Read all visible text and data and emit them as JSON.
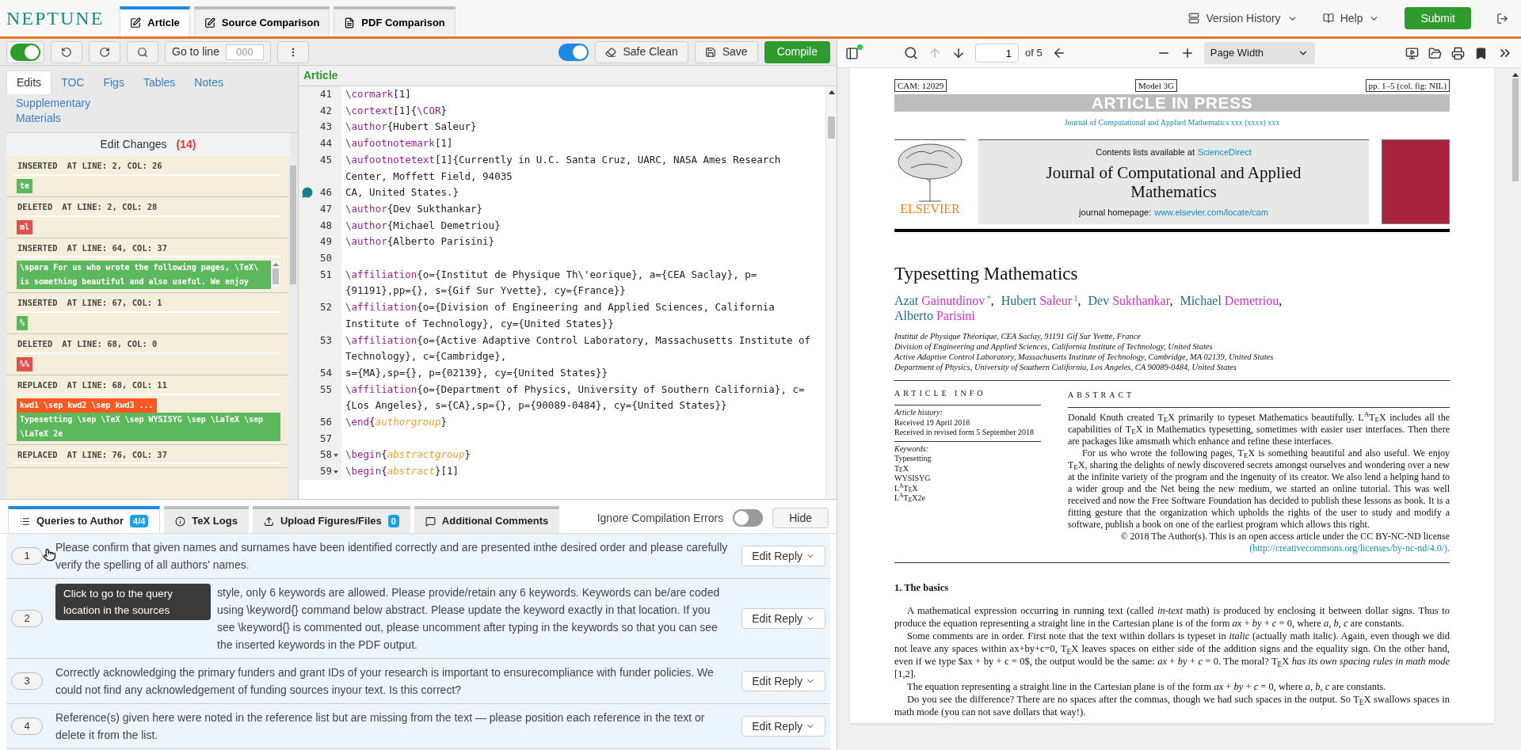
{
  "app": {
    "logo": "NEPTUNE"
  },
  "tabs": [
    {
      "label": "Article",
      "selected": true
    },
    {
      "label": "Source Comparison",
      "selected": false
    },
    {
      "label": "PDF Comparison",
      "selected": false
    }
  ],
  "menus": [
    {
      "label": "Version History"
    },
    {
      "label": "Help"
    }
  ],
  "submit": "Submit",
  "toolbar": {
    "track_on": true,
    "goto_label": "Go to line",
    "goto_placeholder": "000",
    "clean_on": true,
    "safe_clean": "Safe Clean",
    "save": "Save",
    "compile": "Compile"
  },
  "side_tabs": [
    {
      "label": "Edits",
      "selected": true
    },
    {
      "label": "TOC",
      "selected": false
    },
    {
      "label": "Figs",
      "selected": false
    },
    {
      "label": "Tables",
      "selected": false
    },
    {
      "label": "Notes",
      "selected": false
    },
    {
      "label": "Supplementary Materials",
      "selected": false
    }
  ],
  "edit_changes": {
    "title": "Edit Changes",
    "count": "(14)",
    "items": [
      {
        "kind": "inserted",
        "action": "INSERTED",
        "location": "AT LINE: 2, COL: 26",
        "added": "te",
        "scrollable": false
      },
      {
        "kind": "deleted",
        "action": "DELETED",
        "location": "AT LINE: 2, COL: 28",
        "removed": "ml",
        "scrollable": false
      },
      {
        "kind": "inserted",
        "action": "INSERTED",
        "location": "AT LINE: 64, COL: 37",
        "added": "\\spara For us who wrote the following pages, \\TeX\\ is something beautiful and also useful. We enjoy",
        "scrollable": true
      },
      {
        "kind": "inserted",
        "action": "INSERTED",
        "location": "AT LINE: 67, COL: 1",
        "added": "%",
        "scrollable": false
      },
      {
        "kind": "deleted",
        "action": "DELETED",
        "location": "AT LINE: 68, COL: 0",
        "removed": "%%",
        "scrollable": false
      },
      {
        "kind": "replaced",
        "action": "REPLACED",
        "location": "AT LINE: 68, COL: 11",
        "removed": "kwd1 \\sep kwd2 \\sep kwd3 ...",
        "added": "Typesetting \\sep \\TeX \\sep WYSISYG \\sep \\LaTeX \\sep \\LaTeX 2e",
        "scrollable": false
      },
      {
        "kind": "replaced",
        "action": "REPLACED",
        "location": "AT LINE: 76, COL: 37",
        "scrollable": false
      }
    ]
  },
  "editor": {
    "title": "Article",
    "lines": [
      {
        "number": "41",
        "comment": false,
        "foldable": false,
        "tokens": [
          {
            "kind": "command",
            "text": "\\cormark"
          },
          {
            "kind": "plain",
            "text": "[1]"
          }
        ]
      },
      {
        "number": "42",
        "comment": false,
        "foldable": false,
        "tokens": [
          {
            "kind": "command",
            "text": "\\cortext"
          },
          {
            "kind": "plain",
            "text": "[1]{"
          },
          {
            "kind": "command",
            "text": "\\COR"
          },
          {
            "kind": "plain",
            "text": "}"
          }
        ]
      },
      {
        "number": "43",
        "comment": false,
        "foldable": false,
        "tokens": [
          {
            "kind": "command",
            "text": "\\author"
          },
          {
            "kind": "plain",
            "text": "{Hubert Saleur}"
          }
        ]
      },
      {
        "number": "44",
        "comment": false,
        "foldable": false,
        "tokens": [
          {
            "kind": "command",
            "text": "\\aufootnotemark"
          },
          {
            "kind": "plain",
            "text": "[1]"
          }
        ]
      },
      {
        "number": "45",
        "comment": false,
        "foldable": false,
        "tokens": [
          {
            "kind": "command",
            "text": "\\aufootnotetext"
          },
          {
            "kind": "plain",
            "text": "[1]{Currently in U.C. Santa Cruz, UARC, NASA Ames Research Center, Moffett Field, 94035"
          }
        ]
      },
      {
        "number": "46",
        "comment": true,
        "foldable": false,
        "tokens": [
          {
            "kind": "plain",
            "text": "CA, United States.}"
          }
        ]
      },
      {
        "number": "47",
        "comment": false,
        "foldable": false,
        "tokens": [
          {
            "kind": "command",
            "text": "\\author"
          },
          {
            "kind": "plain",
            "text": "{Dev Sukthankar}"
          }
        ]
      },
      {
        "number": "48",
        "comment": false,
        "foldable": false,
        "tokens": [
          {
            "kind": "command",
            "text": "\\author"
          },
          {
            "kind": "plain",
            "text": "{Michael Demetriou}"
          }
        ]
      },
      {
        "number": "49",
        "comment": false,
        "foldable": false,
        "tokens": [
          {
            "kind": "command",
            "text": "\\author"
          },
          {
            "kind": "plain",
            "text": "{Alberto Parisini}"
          }
        ]
      },
      {
        "number": "50",
        "comment": false,
        "foldable": false
      },
      {
        "number": "51",
        "comment": false,
        "foldable": false,
        "tokens": [
          {
            "kind": "command",
            "text": "\\affiliation"
          },
          {
            "kind": "plain",
            "text": "{o={Institut de Physique Th\\'eorique}, a={CEA Saclay}, p={91191},pp={}, s={Gif Sur Yvette}, cy={France}}"
          }
        ]
      },
      {
        "number": "52",
        "comment": false,
        "foldable": false,
        "tokens": [
          {
            "kind": "command",
            "text": "\\affiliation"
          },
          {
            "kind": "plain",
            "text": "{o={Division of Engineering and Applied Sciences, California Institute of Technology}, cy={United States}}"
          }
        ]
      },
      {
        "number": "53",
        "comment": false,
        "foldable": false,
        "tokens": [
          {
            "kind": "command",
            "text": "\\affiliation"
          },
          {
            "kind": "plain",
            "text": "{o={Active Adaptive Control Laboratory, Massachusetts Institute of Technology}, c={Cambridge},"
          }
        ]
      },
      {
        "number": "54",
        "comment": false,
        "foldable": false,
        "tokens": [
          {
            "kind": "plain",
            "text": "s={MA},sp={}, p={02139}, cy={United States}}"
          }
        ]
      },
      {
        "number": "55",
        "comment": false,
        "foldable": false,
        "tokens": [
          {
            "kind": "command",
            "text": "\\affiliation"
          },
          {
            "kind": "plain",
            "text": "{o={Department of Physics, University of Southern California}, c={Los Angeles}, s={CA},sp={}, p={90089-0484}, cy={United States}}"
          }
        ]
      },
      {
        "number": "56",
        "comment": false,
        "foldable": false,
        "tokens": [
          {
            "kind": "command",
            "text": "\\end"
          },
          {
            "kind": "plain",
            "text": "{"
          },
          {
            "kind": "environment",
            "text": "authorgroup"
          },
          {
            "kind": "plain",
            "text": "}"
          }
        ]
      },
      {
        "number": "57",
        "comment": false,
        "foldable": false
      },
      {
        "number": "58",
        "comment": false,
        "foldable": true,
        "tokens": [
          {
            "kind": "command",
            "text": "\\begin"
          },
          {
            "kind": "plain",
            "text": "{"
          },
          {
            "kind": "environment",
            "text": "abstractgroup"
          },
          {
            "kind": "plain",
            "text": "}"
          }
        ]
      },
      {
        "number": "59",
        "comment": false,
        "foldable": true,
        "tokens": [
          {
            "kind": "command",
            "text": "\\begin"
          },
          {
            "kind": "plain",
            "text": "{"
          },
          {
            "kind": "environment",
            "text": "abstract"
          },
          {
            "kind": "plain",
            "text": "}[1]"
          }
        ]
      }
    ]
  },
  "bottom_tabs": [
    {
      "label": "Queries to Author",
      "badge": "4/4",
      "selected": true
    },
    {
      "label": "TeX Logs",
      "selected": false
    },
    {
      "label": "Upload Figures/Files",
      "badge": "0",
      "selected": false
    },
    {
      "label": "Additional Comments",
      "selected": false
    }
  ],
  "ignore_errors": {
    "label": "Ignore Compilation Errors",
    "on": false
  },
  "hide": "Hide",
  "queries": [
    {
      "number": "1",
      "text": "Please confirm that given names and surnames have been identified correctly and are presented inthe desired order and please carefully verify the spelling of all authors' names.",
      "action": "Edit Reply",
      "tooltip": "Click to go to the query location in the sources"
    },
    {
      "number": "2",
      "text": "style, only 6 keywords are allowed. Please provide/retain any 6 keywords. Keywords can be/are coded using \\keyword{} command below abstract. Please update the keyword exactly in that location. If you see \\keyword{} is commented out, please uncomment after typing in the keywords so that you can see the inserted keywords in the PDF output.",
      "action": "Edit Reply"
    },
    {
      "number": "3",
      "text": "Correctly acknowledging the primary funders and grant IDs of your research is important to ensurecompliance with funder policies. We could not find any acknowledgement of funding sources inyour text. Is this correct?",
      "action": "Edit Reply"
    },
    {
      "number": "4",
      "text": "Reference(s) given here were noted in the reference list but are missing from the text — please position each reference in the text or delete it from the list.",
      "action": "Edit Reply"
    }
  ],
  "pdf": {
    "toolbar": {
      "page": "1",
      "of": "of 5",
      "zoom": "Page Width"
    },
    "page": {
      "header": [
        "CAM: 12029",
        "Model 3G",
        "pp. 1–5 (col. fig: NIL)"
      ],
      "banner": "ARTICLE IN PRESS",
      "journal_ref": "Journal of Computational and Applied Mathematics xxx (xxxx) xxx",
      "publisher": "ELSEVIER",
      "contents_prefix": "Contents lists available at",
      "contents_link": "ScienceDirect",
      "journal_title": "Journal of Computational and Applied Mathematics",
      "homepage_prefix": "journal homepage:",
      "homepage_link": "www.elsevier.com/locate/cam",
      "title": "Typesetting Mathematics",
      "authors": [
        {
          "given": "Azat",
          "surname": "Gainutdinov",
          "mark": "*",
          "after": ","
        },
        {
          "given": "Hubert",
          "surname": "Saleur",
          "mark": "1",
          "after": ","
        },
        {
          "given": "Dev",
          "surname": "Sukthankar",
          "after": ","
        },
        {
          "given": "Michael",
          "surname": "Demetriou",
          "after": ","
        },
        {
          "given": "Alberto",
          "surname": "Parisini"
        }
      ],
      "affiliations": [
        "Institut de Physique Théorique, CEA Saclay, 91191 Gif Sur Yvette, France",
        "Division of Engineering and Applied Sciences, California Institute of Technology, United States",
        "Active Adaptive Control Laboratory, Massachusetts Institute of Technology, Cambridge, MA 02139, United States",
        "Department of Physics, University of Southern California, Los Angeles, CA 90089-0484, United States"
      ],
      "info_heading": "ARTICLE INFO",
      "history_label": "Article history:",
      "history": [
        "Received 19 April 2018",
        "Received in revised form 5 September 2018"
      ],
      "keywords_label": "Keywords:",
      "keywords": [
        "Typesetting",
        "T$_{E}$X",
        "WYSISYG",
        "L$^{A}$T$_{E}$X",
        "L$^{A}$T$_{E}$X2e"
      ],
      "abstract_heading": "ABSTRACT",
      "abstract": [
        "Donald Knuth created T$_{E}$X primarily to typeset Mathematics beautifully. L$^{A}$T$_{E}$X includes all the capabilities of T$_{E}$X in Mathematics typesetting, sometimes with easier user interfaces. Then there are packages like amsmath which enhance and refine these interfaces.",
        "For us who wrote the following pages, T$_{E}$X is something beautiful and also useful. We enjoy T$_{E}$X, sharing the delights of newly discovered secrets amongst ourselves and wondering over a new at the infinite variety of the program and the ingenuity of its creator. We also lend a helping hand to a wider group and the Net being the new medium, we started an online tutorial. This was well received and now the Free Software Foundation has decided to publish these lessons as book. It is a fitting gesture that the organization which upholds the rights of the user to study and modify a software, publish a book on one of the earliest program which allows this right."
      ],
      "copyright": "© 2018 The Author(s). This is an open access article under the CC BY-NC-ND license",
      "license_link": "(http://creativecommons.org/licenses/by-nc-nd/4.0/).",
      "section": "1.  The basics",
      "paragraphs": [
        "A mathematical expression occurring in running text (called *in-text* math) is produced by enclosing it between dollar signs. Thus to produce the equation representing a straight line in the Cartesian plane is of the form *ax* + *by* + *c* = 0, where *a*, *b*, *c* are constants.",
        "Some comments are in order. First note that the text within dollars is typeset in *italic* (actually math italic). Again, even though we did not leave any spaces within ax+by+c=0, T$_{E}$X leaves spaces on either side of the addition signs and the equality sign. On the other hand, even if we type $ax + by + c = 0$, the output would be the same: *ax* + *by* + *c* = 0. The moral? T$_{E}$X *has its own spacing rules in math mode* [1,2].",
        "The equation representing a straight line in the Cartesian plane is of the form *ax* + *by* + *c* = 0, where *a*, *b*, *c* are constants.",
        "Do you see the difference? There are no spaces after the commas, though we had such spaces in the output. So T$_{E}$X swallows spaces in math mode (you can not save dollars that way!)."
      ]
    }
  }
}
